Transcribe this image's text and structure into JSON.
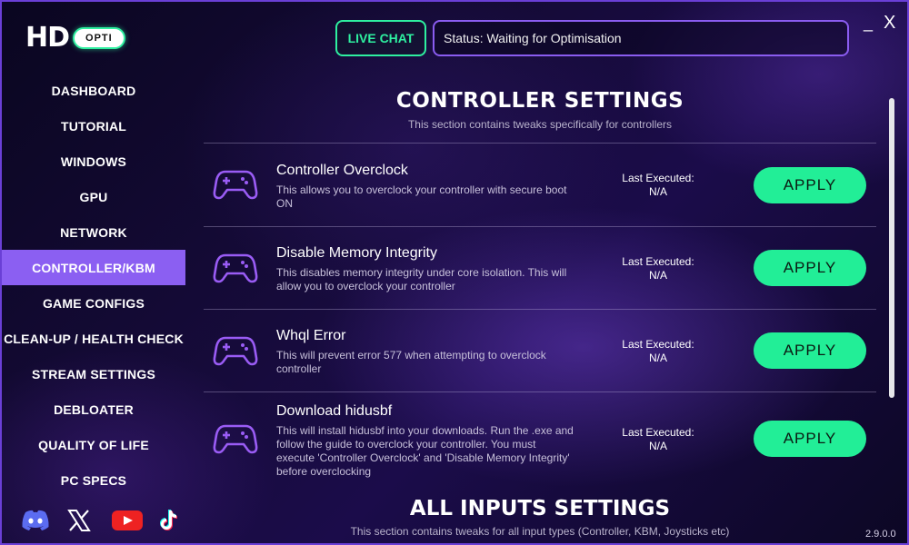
{
  "window": {
    "minimize": "_",
    "close": "X",
    "version": "2.9.0.0"
  },
  "logo": {
    "main": "HD",
    "pill": "OPTI"
  },
  "topbar": {
    "live_chat": "LIVE CHAT",
    "status": "Status: Waiting for Optimisation"
  },
  "sidebar": {
    "items": [
      {
        "label": "DASHBOARD"
      },
      {
        "label": "TUTORIAL"
      },
      {
        "label": "WINDOWS"
      },
      {
        "label": "GPU"
      },
      {
        "label": "NETWORK"
      },
      {
        "label": "CONTROLLER/KBM"
      },
      {
        "label": "GAME CONFIGS"
      },
      {
        "label": "CLEAN-UP / HEALTH CHECK"
      },
      {
        "label": "STREAM SETTINGS"
      },
      {
        "label": "DEBLOATER"
      },
      {
        "label": "QUALITY OF LIFE"
      },
      {
        "label": "PC SPECS"
      }
    ],
    "active_index": 5,
    "socials": [
      "discord-icon",
      "x-icon",
      "youtube-icon",
      "tiktok-icon"
    ]
  },
  "controller_section": {
    "title": "CONTROLLER SETTINGS",
    "subtitle": "This section contains tweaks specifically for controllers",
    "tweaks": [
      {
        "title": "Controller Overclock",
        "description": "This allows you to overclock your controller with secure boot ON",
        "last_executed_label": "Last Executed:",
        "last_executed_value": "N/A",
        "button": "APPLY"
      },
      {
        "title": "Disable Memory Integrity",
        "description": "This disables memory integrity under core isolation. This will allow you to overclock your controller",
        "last_executed_label": "Last Executed:",
        "last_executed_value": "N/A",
        "button": "APPLY"
      },
      {
        "title": "Whql Error",
        "description": "This will prevent error 577 when attempting to overclock controller",
        "last_executed_label": "Last Executed:",
        "last_executed_value": "N/A",
        "button": "APPLY"
      },
      {
        "title": "Download hidusbf",
        "description": "This will install hidusbf into your downloads. Run the .exe and follow the guide to overclock your controller. You must execute 'Controller Overclock' and 'Disable Memory Integrity' before overclocking",
        "last_executed_label": "Last Executed:",
        "last_executed_value": "N/A",
        "button": "APPLY"
      }
    ]
  },
  "inputs_section": {
    "title": "ALL INPUTS SETTINGS",
    "subtitle": "This section contains tweaks for all input types (Controller, KBM, Joysticks etc)"
  },
  "colors": {
    "accent_green": "#22ee97",
    "accent_purple": "#8b5ff2",
    "icon_purple": "#9a5cf5"
  }
}
